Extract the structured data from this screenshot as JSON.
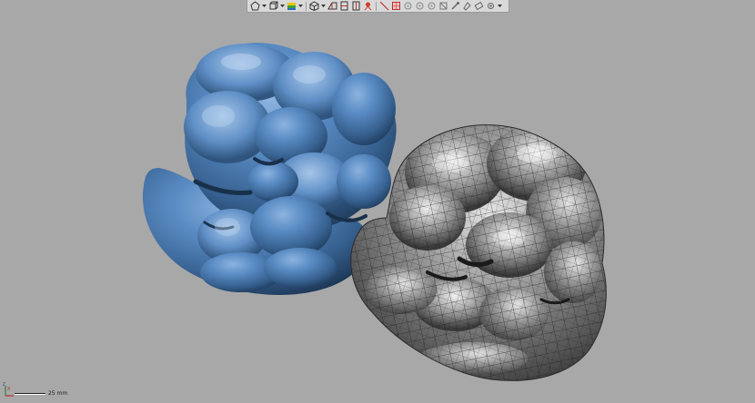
{
  "toolbar": {
    "buttons": [
      {
        "name": "select-shape-icon"
      },
      {
        "name": "dropdown-caret-icon"
      },
      {
        "name": "box-view-icon"
      },
      {
        "name": "dropdown-caret-icon"
      },
      {
        "name": "color-display-icon"
      },
      {
        "name": "dropdown-caret-icon"
      },
      {
        "name": "cube-view-icon"
      },
      {
        "name": "dropdown-caret-icon"
      },
      {
        "name": "section-view-icon"
      },
      {
        "name": "clip-plane-icon"
      },
      {
        "name": "clip-plane-icon"
      },
      {
        "name": "light-icon"
      },
      {
        "name": "measure-line-icon"
      },
      {
        "name": "snap-grid-icon"
      },
      {
        "name": "point-icon"
      },
      {
        "name": "point-icon"
      },
      {
        "name": "point-icon"
      },
      {
        "name": "hide-icon"
      },
      {
        "name": "brush-icon"
      },
      {
        "name": "paint-icon"
      },
      {
        "name": "eraser-icon"
      },
      {
        "name": "settings-icon"
      },
      {
        "name": "dropdown-caret-icon"
      }
    ]
  },
  "scale": {
    "label": "25 mm"
  },
  "axis": {
    "x_label": "X",
    "z_label": "Z"
  },
  "colors": {
    "background": "#a8a8a8",
    "scan_model": "#4d7fb6",
    "quad_mesh": "#6a6a6a"
  }
}
